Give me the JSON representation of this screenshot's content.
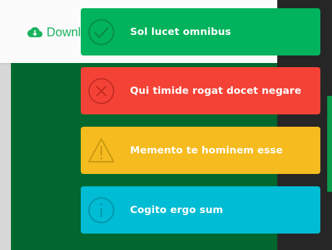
{
  "background": {
    "download_label": "Downl",
    "colors": {
      "green_panel": "#00672f",
      "dark_panel": "#262626",
      "accent": "#0a9c4a"
    }
  },
  "toasts": [
    {
      "type": "success",
      "icon": "check-circle-icon",
      "message": "Sol lucet omnibus",
      "color": "#00b35c"
    },
    {
      "type": "error",
      "icon": "close-circle-icon",
      "message": "Qui timide rogat docet negare",
      "color": "#f44336"
    },
    {
      "type": "warning",
      "icon": "warning-triangle-icon",
      "message": "Memento te hominem esse",
      "color": "#f5bb1f"
    },
    {
      "type": "info",
      "icon": "info-circle-icon",
      "message": "Cogito ergo sum",
      "color": "#00bcd4"
    }
  ]
}
